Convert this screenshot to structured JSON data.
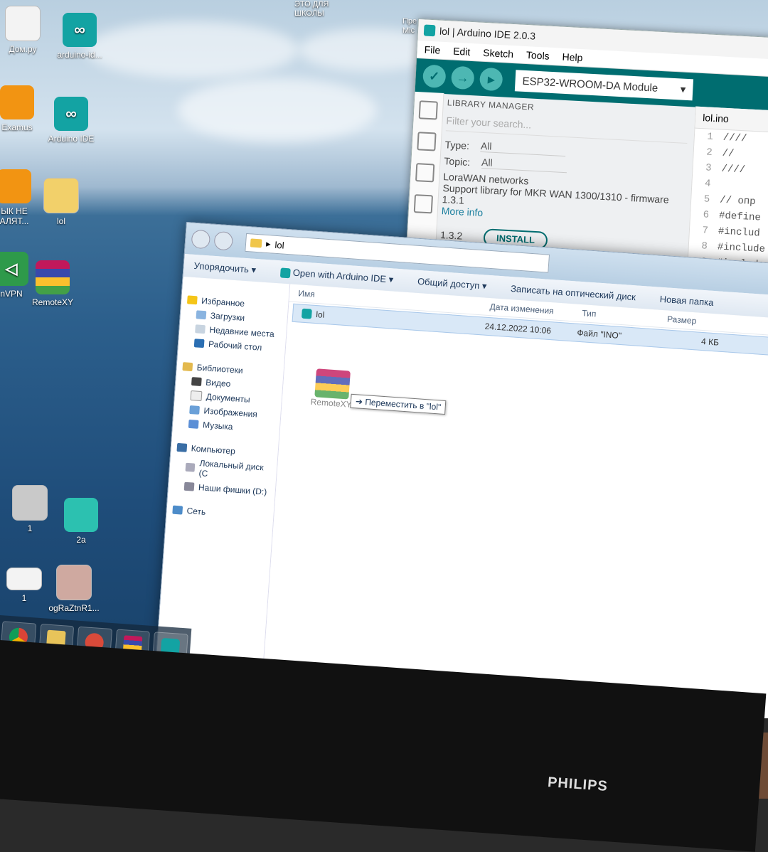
{
  "desktop": {
    "icons": [
      {
        "label": "Дом.ру",
        "kind": "doc"
      },
      {
        "label": "arduino-id...",
        "kind": "ard"
      },
      {
        "label": "Examus",
        "kind": "pin"
      },
      {
        "label": "Arduino IDE",
        "kind": "ard"
      },
      {
        "label": "ЫК НЕ АЛЯТ...",
        "kind": "pin"
      },
      {
        "label": "lol",
        "kind": "doc"
      },
      {
        "label": "nVPN",
        "kind": "ard"
      },
      {
        "label": "RemoteXY",
        "kind": "rar"
      },
      {
        "label": "1",
        "kind": "doc"
      },
      {
        "label": "2a",
        "kind": "ard"
      },
      {
        "label": "1",
        "kind": "doc"
      },
      {
        "label": "ogRaZtnR1...",
        "kind": "doc"
      }
    ],
    "top_labels": [
      "ЭТО ДЛЯ ШКОЛЫ",
      "Пре Mic"
    ]
  },
  "ide": {
    "title": "lol | Arduino IDE 2.0.3",
    "menu": [
      "File",
      "Edit",
      "Sketch",
      "Tools",
      "Help"
    ],
    "board": "ESP32-WROOM-DA Module",
    "library_manager": {
      "heading": "LIBRARY MANAGER",
      "search_placeholder": "Filter your search...",
      "type_label": "Type:",
      "type_value": "All",
      "topic_label": "Topic:",
      "topic_value": "All",
      "lib_name": "LoraWAN networks",
      "lib_desc": "Support library for MKR WAN 1300/1310 - firmware 1.3.1",
      "more_info": "More info",
      "version": "1.3.2",
      "install": "INSTALL"
    },
    "editor": {
      "tab": "lol.ino",
      "lines": [
        {
          "n": "1",
          "code": "////"
        },
        {
          "n": "2",
          "code": "//"
        },
        {
          "n": "3",
          "code": "////"
        },
        {
          "n": "4",
          "code": ""
        },
        {
          "n": "5",
          "code": "// опр"
        },
        {
          "n": "6",
          "code": "#define"
        },
        {
          "n": "7",
          "code": "#includ"
        },
        {
          "n": "8",
          "code": "#include"
        },
        {
          "n": "9",
          "code": "#include"
        }
      ]
    }
  },
  "explorer": {
    "path": "lol",
    "commands": {
      "organize": "Упорядочить",
      "open_with": "Open with Arduino IDE",
      "share": "Общий доступ",
      "burn": "Записать на оптический диск",
      "new_folder": "Новая папка"
    },
    "nav": {
      "favorites": "Избранное",
      "downloads": "Загрузки",
      "recent": "Недавние места",
      "desktop": "Рабочий стол",
      "libraries": "Библиотеки",
      "video": "Видео",
      "documents": "Документы",
      "images": "Изображения",
      "music": "Музыка",
      "computer": "Компьютер",
      "local_disk": "Локальный диск (C",
      "usb": "Наши фишки (D:)",
      "network": "Сеть"
    },
    "columns": {
      "name": "Имя",
      "date": "Дата изменения",
      "type": "Тип",
      "size": "Размер"
    },
    "file": {
      "name": "lol",
      "date": "24.12.2022 10:06",
      "type": "Файл \"INO\"",
      "size": "4 КБ"
    },
    "drag_label": "RemoteXY",
    "drag_tip": "Переместить в \"lol\""
  },
  "monitor_brand": "PHILIPS"
}
